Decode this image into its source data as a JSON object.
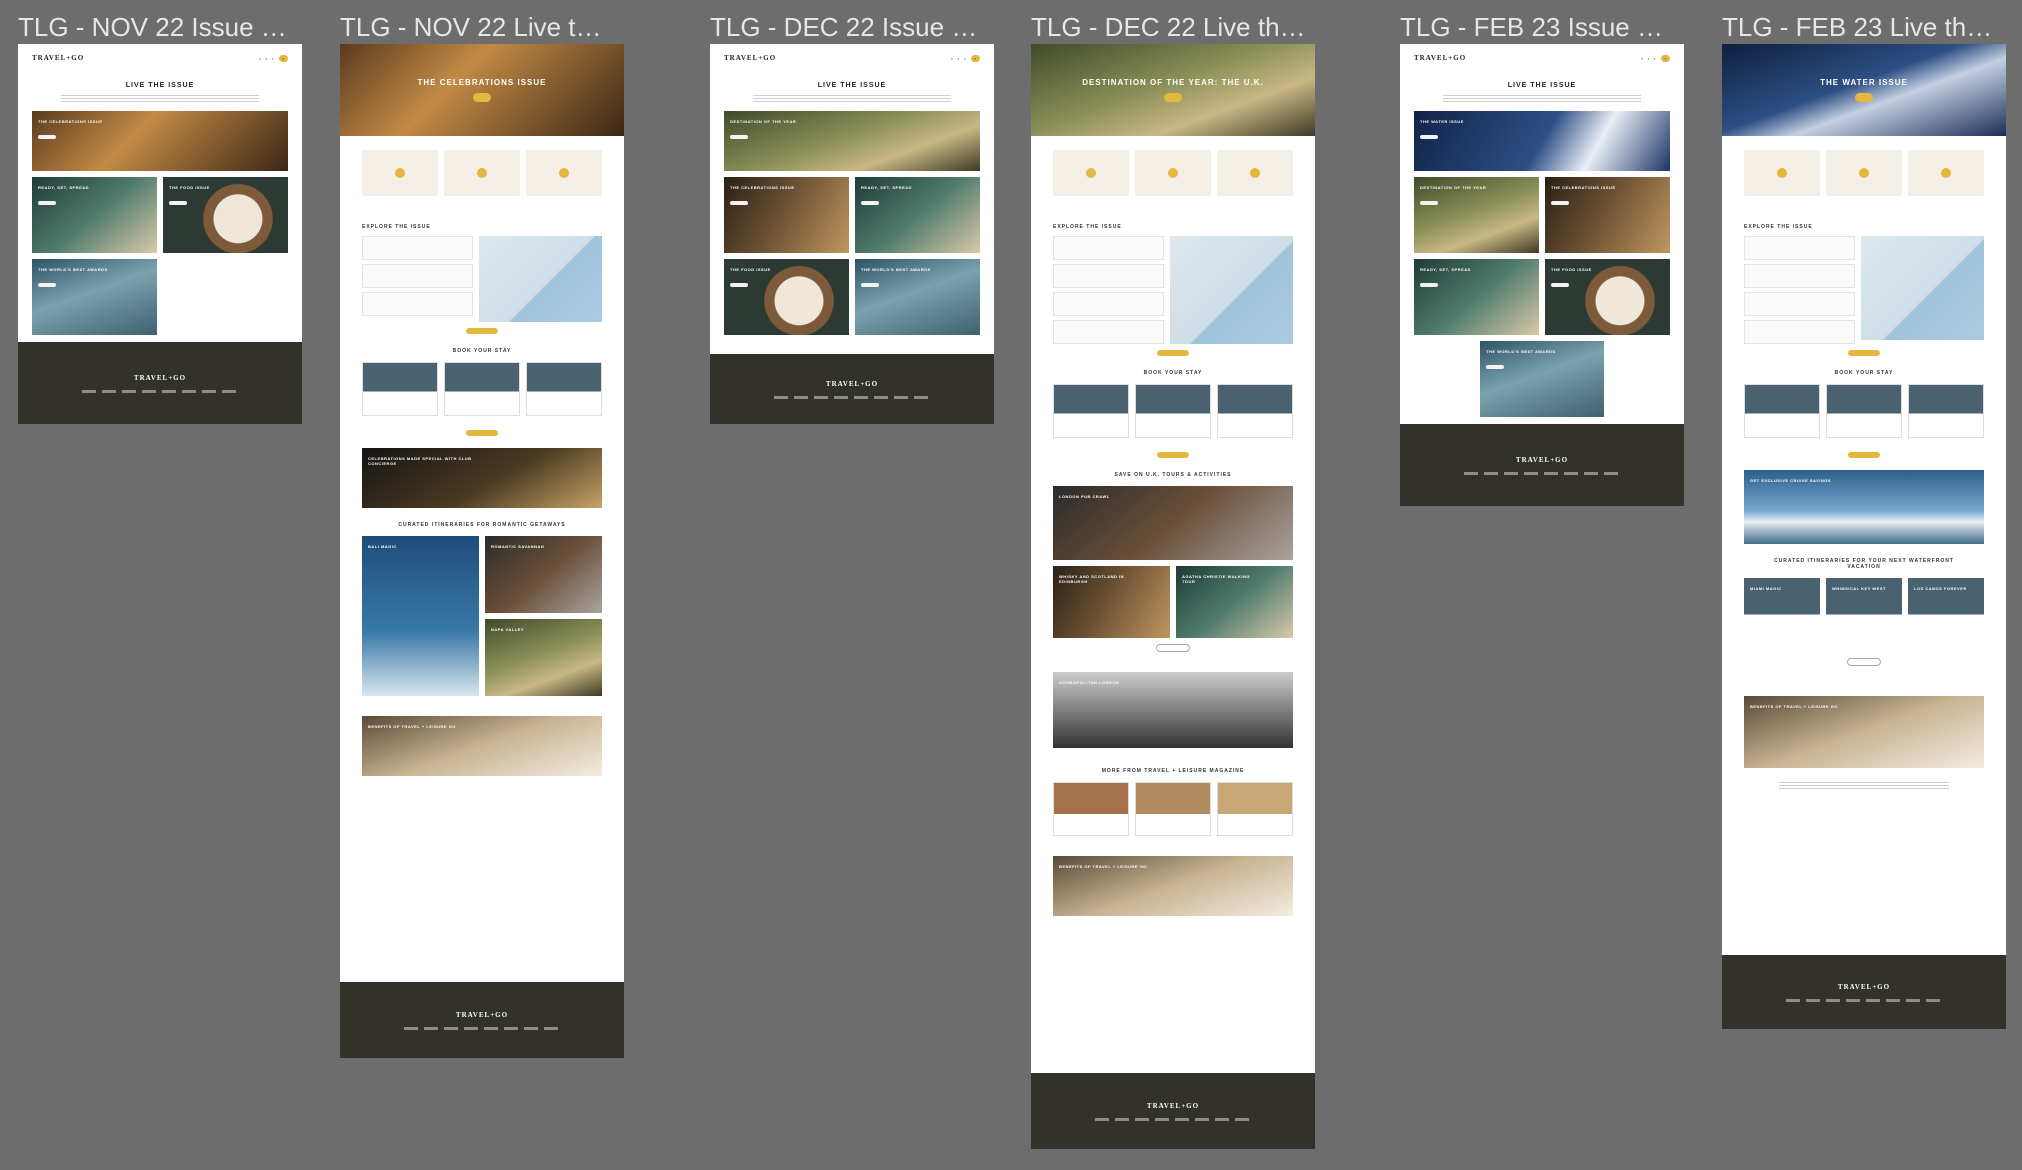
{
  "frames": [
    {
      "title": "TLG - NOV 22 Issue Lan..."
    },
    {
      "title": "TLG - NOV 22 Live the i..."
    },
    {
      "title": "TLG - DEC 22 Issue Lan..."
    },
    {
      "title": "TLG - DEC 22 Live the i..."
    },
    {
      "title": "TLG - FEB 23 Issue Lan..."
    },
    {
      "title": "TLG - FEB 23 Live the is..."
    }
  ],
  "site": {
    "logo": "TRAVEL+GO"
  },
  "nov_landing": {
    "intro_title": "LIVE THE ISSUE",
    "cards": [
      "THE CELEBRATIONS ISSUE",
      "READY, SET, SPREAD",
      "THE FOOD ISSUE",
      "THE WORLD'S BEST AWARDS"
    ]
  },
  "nov_live": {
    "hero_title": "THE CELEBRATIONS ISSUE",
    "sections": [
      "EXPLORE THE ISSUE",
      "BOOK YOUR STAY",
      "CELEBRATIONS MADE SPECIAL WITH CLUB CONCIERGE",
      "CURATED ITINERARIES FOR ROMANTIC GETAWAYS",
      "BENEFITS OF TRAVEL + LEISURE GO"
    ],
    "itineraries": [
      "BALI MAGIC",
      "ROMANTIC SAVANNAH",
      "NAPA VALLEY"
    ]
  },
  "dec_landing": {
    "intro_title": "LIVE THE ISSUE",
    "cards": [
      "DESTINATION OF THE YEAR",
      "THE CELEBRATIONS ISSUE",
      "READY, SET, SPREAD",
      "THE FOOD ISSUE",
      "THE WORLD'S BEST AWARDS"
    ]
  },
  "dec_live": {
    "hero_title": "DESTINATION OF THE YEAR: THE U.K.",
    "sections": [
      "EXPLORE THE ISSUE",
      "BOOK YOUR STAY",
      "SAVE ON U.K. TOURS & ACTIVITIES",
      "MORE FROM TRAVEL + LEISURE MAGAZINE",
      "BENEFITS OF TRAVEL + LEISURE GO"
    ],
    "tours": [
      "LONDON PUB CRAWL",
      "WHISKY AND SCOTLAND IN EDINBURGH",
      "AGATHA CHRISTIE WALKING TOUR",
      "COSMOPOLITAN LONDON"
    ]
  },
  "feb_landing": {
    "intro_title": "LIVE THE ISSUE",
    "cards": [
      "THE WATER ISSUE",
      "DESTINATION OF THE YEAR",
      "THE CELEBRATIONS ISSUE",
      "READY, SET, SPREAD",
      "THE FOOD ISSUE",
      "THE WORLD'S BEST AWARDS"
    ]
  },
  "feb_live": {
    "hero_title": "THE WATER ISSUE",
    "sections": [
      "EXPLORE THE ISSUE",
      "BOOK YOUR STAY",
      "GET EXCLUSIVE CRUISE SAVINGS",
      "CURATED ITINERARIES FOR YOUR NEXT WATERFRONT VACATION",
      "BENEFITS OF TRAVEL + LEISURE GO"
    ],
    "itineraries": [
      "MIAMI MAGIC",
      "WHIMSICAL KEY WEST",
      "LOS CABOS FOREVER"
    ]
  }
}
